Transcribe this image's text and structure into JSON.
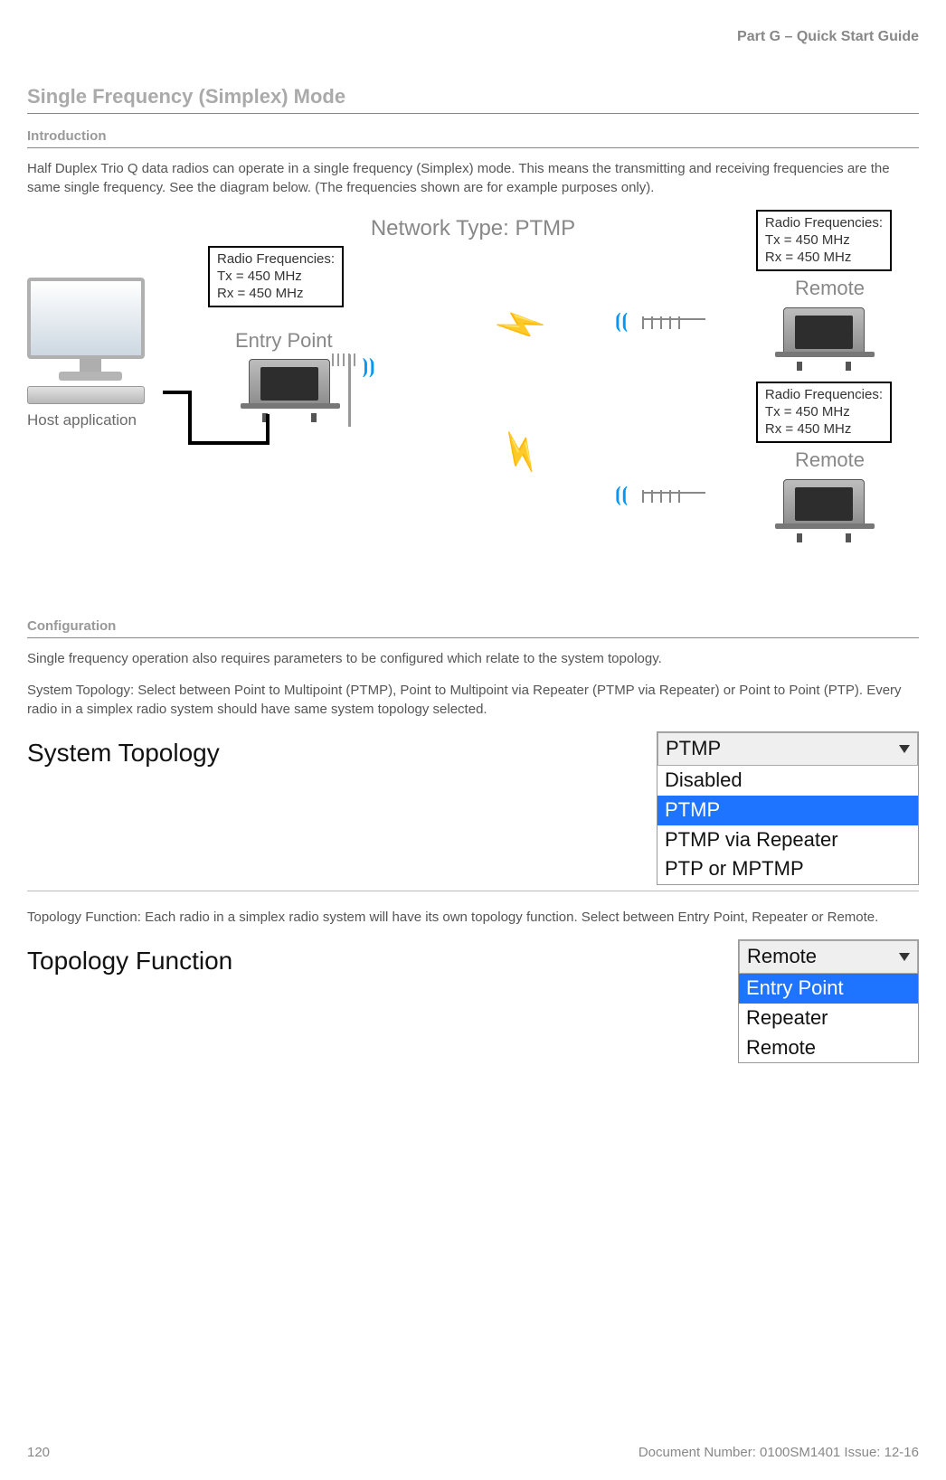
{
  "header": {
    "part": "Part G – Quick Start Guide"
  },
  "title": "Single Frequency (Simplex) Mode",
  "sections": {
    "intro_h": "Introduction",
    "intro_p": "Half Duplex Trio Q data radios can operate in a single frequency (Simplex) mode. This means the transmitting and receiving frequencies are the same single frequency. See the diagram below. (The frequencies shown are for example purposes only).",
    "config_h": "Configuration",
    "config_p1": "Single frequency operation also requires parameters to be configured which relate to the system topology.",
    "config_p2": "System Topology: Select between Point to Multipoint (PTMP), Point to Multipoint via Repeater (PTMP via Repeater) or Point to Point (PTP). Every radio in a simplex radio system should have same system topology selected.",
    "config_p3": "Topology Function: Each radio in a simplex radio system will have its own topology function. Select between Entry Point, Repeater or Remote."
  },
  "diagram": {
    "network_type": "Network Type: PTMP",
    "host_label": "Host application",
    "entry_label": "Entry Point",
    "remote_label1": "Remote",
    "remote_label2": "Remote",
    "freq": {
      "title": "Radio Frequencies:",
      "tx": "Tx = 450 MHz",
      "rx": "Rx = 450 MHz"
    }
  },
  "system_topology": {
    "label": "System Topology",
    "selected": "PTMP",
    "options": [
      "Disabled",
      "PTMP",
      "PTMP via Repeater",
      "PTP or MPTMP"
    ],
    "highlight_index": 1
  },
  "topology_function": {
    "label": "Topology Function",
    "selected": "Remote",
    "options": [
      "Entry Point",
      "Repeater",
      "Remote"
    ],
    "highlight_index": 0
  },
  "footer": {
    "page": "120",
    "doc": "Document Number: 0100SM1401   Issue: 12-16"
  }
}
